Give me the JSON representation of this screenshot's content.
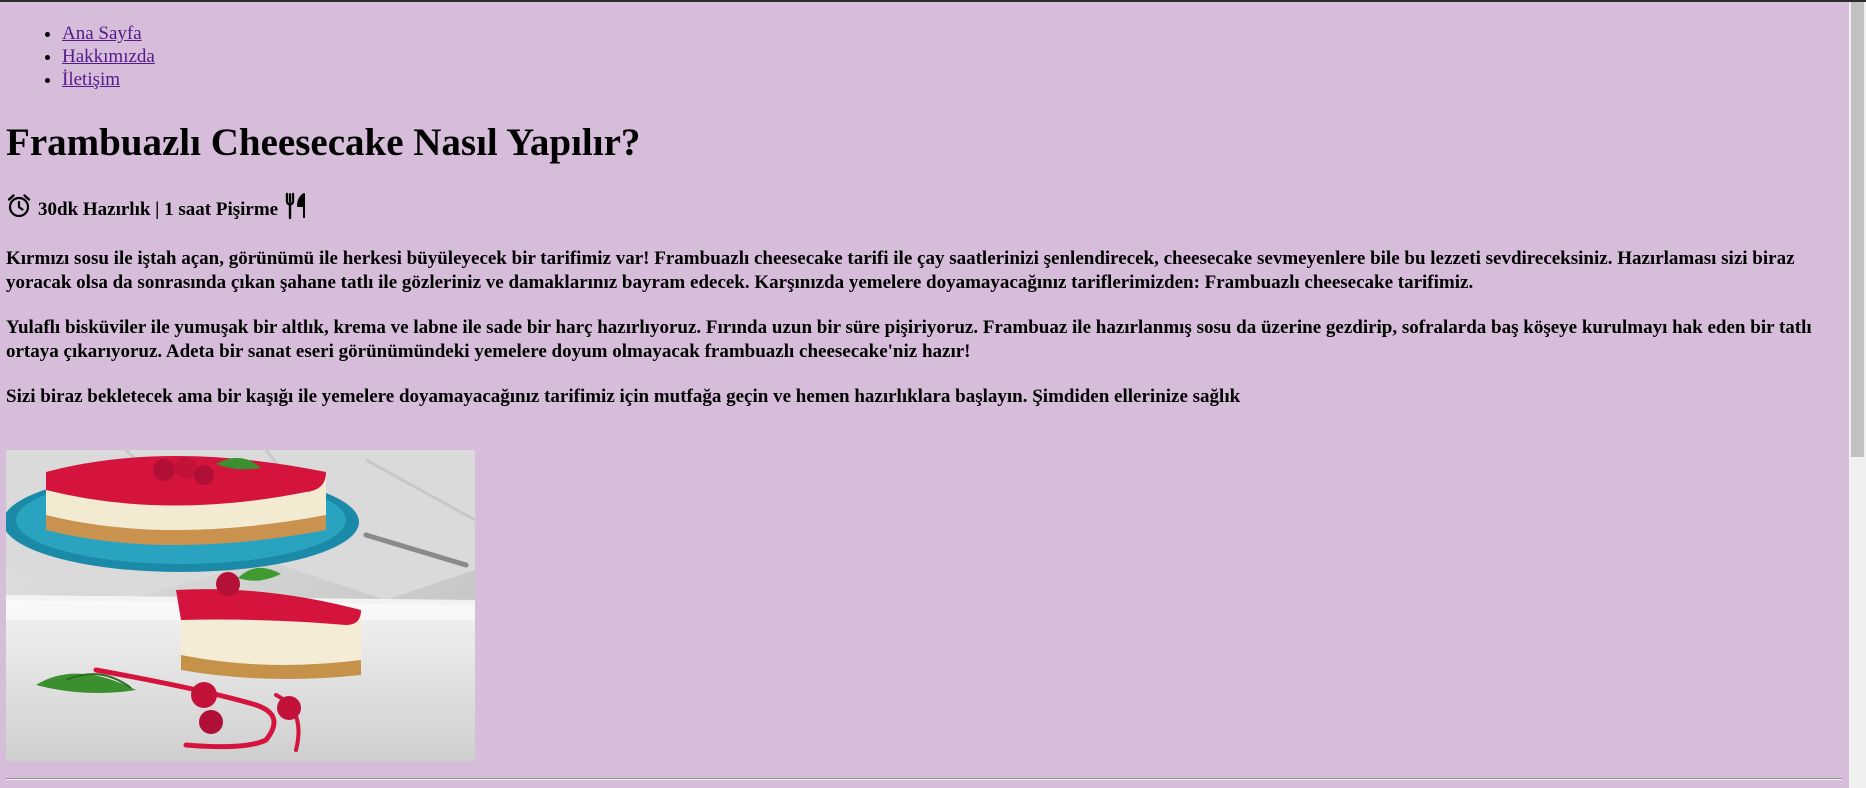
{
  "nav": {
    "items": [
      {
        "label": "Ana Sayfa"
      },
      {
        "label": "Hakkımızda"
      },
      {
        "label": "İletişim"
      }
    ]
  },
  "recipe": {
    "title": "Frambuazlı Cheesecake Nasıl Yapılır?",
    "meta": "30dk Hazırlık | 1 saat Pişirme",
    "meta_icons": [
      "alarm-clock-icon",
      "fork-knife-icon"
    ],
    "paragraphs": [
      "Kırmızı sosu ile iştah açan, görünümü ile herkesi büyüleyecek bir tarifimiz var! Frambuazlı cheesecake tarifi ile çay saatlerinizi şenlendirecek, cheesecake sevmeyenlere bile bu lezzeti sevdireceksiniz. Hazırlaması sizi biraz yoracak olsa da sonrasında çıkan şahane tatlı ile gözleriniz ve damaklarınız bayram edecek. Karşınızda yemelere doyamayacağınız tariflerimizden: Frambuazlı cheesecake tarifimiz.",
      "Yulaflı bisküviler ile yumuşak bir altlık, krema ve labne ile sade bir harç hazırlıyoruz. Fırında uzun bir süre pişiriyoruz. Frambuaz ile hazırlanmış sosu da üzerine gezdirip, sofralarda baş köşeye kurulmayı hak eden bir tatlı ortaya çıkarıyoruz. Adeta bir sanat eseri görünümündeki yemelere doyum olmayacak frambuazlı cheesecake'niz hazır!",
      "Sizi biraz bekletecek ama bir kaşığı ile yemelere doyamayacağınız tarifimiz için mutfağa geçin ve hemen hazırlıklara başlayın. Şimdiden ellerinize sağlık"
    ]
  },
  "colors": {
    "background": "#d6bdda",
    "link": "#551a8b",
    "sauce": "#d4143c"
  }
}
